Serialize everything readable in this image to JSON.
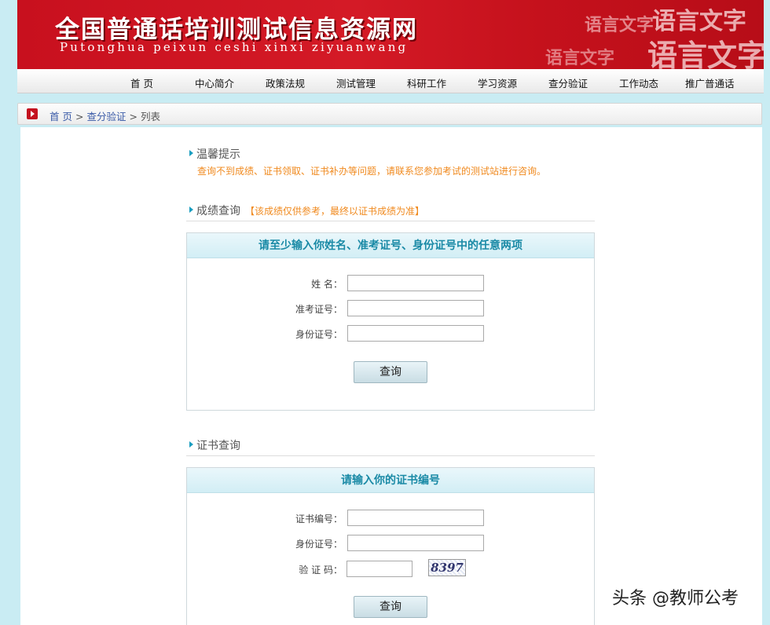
{
  "banner": {
    "title": "全国普通话培训测试信息资源网",
    "subtitle": "Putonghua peixun ceshi xinxi ziyuanwang",
    "calligraphy_1": "语言文字",
    "calligraphy_2": "语言文字",
    "calligraphy_3": "语言文字",
    "calligraphy_4": "语言文字"
  },
  "nav": {
    "items": [
      {
        "label": "首  页"
      },
      {
        "label": "中心简介"
      },
      {
        "label": "政策法规"
      },
      {
        "label": "测试管理"
      },
      {
        "label": "科研工作"
      },
      {
        "label": "学习资源"
      },
      {
        "label": "查分验证"
      },
      {
        "label": "工作动态"
      },
      {
        "label": "推广普通话"
      }
    ]
  },
  "breadcrumb": {
    "home": "首  页",
    "sep": ">",
    "section": "查分验证",
    "current": "列表"
  },
  "tips": {
    "heading": "温馨提示",
    "text": "查询不到成绩、证书领取、证书补办等问题，请联系您参加考试的测试站进行咨询。"
  },
  "score_query": {
    "heading": "成绩查询",
    "note": "【该成绩仅供参考，最终以证书成绩为准】",
    "box_title": "请至少输入你姓名、准考证号、身份证号中的任意两项",
    "fields": [
      {
        "label": "姓      名：",
        "value": ""
      },
      {
        "label": "准考证号：",
        "value": ""
      },
      {
        "label": "身份证号：",
        "value": ""
      }
    ],
    "button": "查询"
  },
  "cert_query": {
    "heading": "证书查询",
    "box_title": "请输入你的证书编号",
    "fields": [
      {
        "label": "证书编号：",
        "value": ""
      },
      {
        "label": "身份证号：",
        "value": ""
      },
      {
        "label": "验  证  码：",
        "value": ""
      }
    ],
    "captcha": "8397",
    "button": "查询"
  },
  "watermark": "头条 @教师公考",
  "colors": {
    "banner_red": "#c8101e",
    "link_blue": "#3b5ba8",
    "tip_orange": "#f08a1f",
    "box_title_teal": "#1a8aa6",
    "page_bg": "#c9ecf3"
  }
}
